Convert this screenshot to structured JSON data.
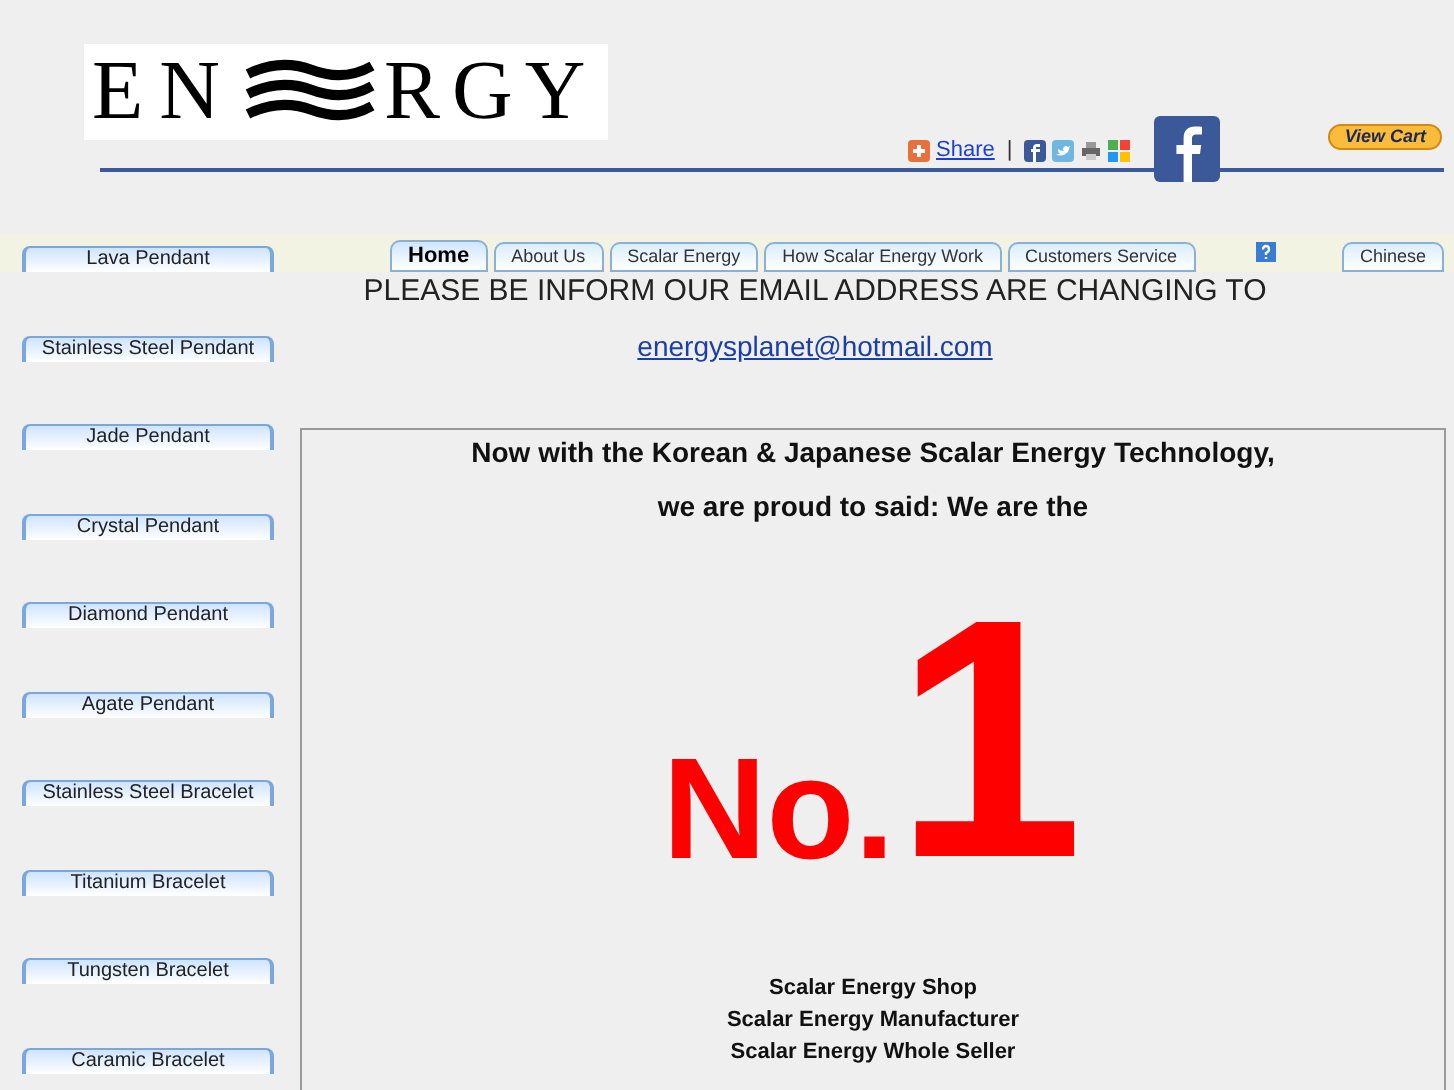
{
  "logo": {
    "left": "EN",
    "right": "RGY"
  },
  "share": {
    "label": "Share",
    "separator": "|"
  },
  "cart_button": "View Cart",
  "tabs": [
    {
      "label": "Home",
      "selected": true
    },
    {
      "label": "About Us",
      "selected": false
    },
    {
      "label": "Scalar Energy",
      "selected": false
    },
    {
      "label": "How Scalar Energy Work",
      "selected": false
    },
    {
      "label": "Customers Service",
      "selected": false
    }
  ],
  "language_tab": "Chinese",
  "sidebar": {
    "items": [
      "Lava Pendant",
      "Stainless Steel Pendant",
      "Jade Pendant",
      "Crystal Pendant",
      "Diamond Pendant",
      "Agate Pendant",
      "Stainless Steel Bracelet",
      "Titanium Bracelet",
      "Tungsten Bracelet",
      "Caramic Bracelet"
    ]
  },
  "notice": {
    "text": "PLEASE BE INFORM OUR EMAIL ADDRESS ARE CHANGING TO",
    "email": "energysplanet@hotmail.com"
  },
  "main": {
    "headline": [
      "Now with the Korean & Japanese Scalar Energy Technology,",
      "we are proud to said: We are the"
    ],
    "rank_prefix": "No.",
    "rank_number": "1",
    "roles": [
      "Scalar Energy Shop",
      "Scalar Energy Manufacturer",
      "Scalar Energy Whole Seller"
    ]
  }
}
